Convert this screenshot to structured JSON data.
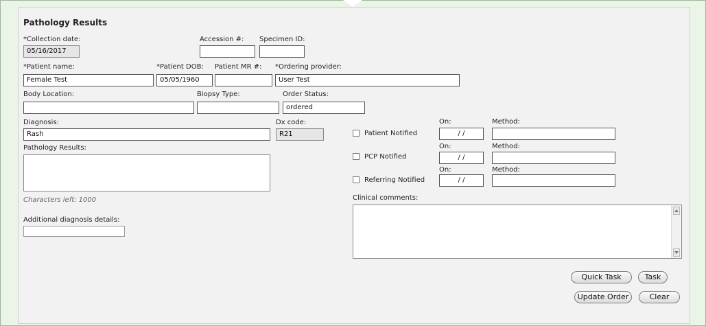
{
  "form": {
    "title": "Pathology Results",
    "collection_date": {
      "label": "*Collection date:",
      "value": "05/16/2017"
    },
    "accession": {
      "label": "Accession #:",
      "value": ""
    },
    "specimen_id": {
      "label": "Specimen ID:",
      "value": ""
    },
    "patient_name": {
      "label": "*Patient name:",
      "value": "Female Test"
    },
    "patient_dob": {
      "label": "*Patient DOB:",
      "value": "05/05/1960"
    },
    "patient_mr": {
      "label": "Patient MR #:",
      "value": ""
    },
    "ordering_provider": {
      "label": "*Ordering provider:",
      "value": "User Test"
    },
    "body_location": {
      "label": "Body Location:",
      "value": ""
    },
    "biopsy_type": {
      "label": "Biopsy Type:",
      "value": ""
    },
    "order_status": {
      "label": "Order Status:",
      "value": "ordered"
    },
    "diagnosis": {
      "label": "Diagnosis:",
      "value": "Rash"
    },
    "dx_code": {
      "label": "Dx code:",
      "value": "R21"
    },
    "pathology_results": {
      "label": "Pathology Results:",
      "value": ""
    },
    "characters_left": "Characters left: 1000",
    "additional_details": {
      "label": "Additional diagnosis details:",
      "value": ""
    },
    "clinical_comments": {
      "label": "Clinical comments:",
      "value": ""
    }
  },
  "notifications": [
    {
      "label": "Patient Notified",
      "on_label": "On:",
      "on_value": " /  /",
      "method_label": "Method:",
      "method_value": "",
      "checked": false
    },
    {
      "label": "PCP Notified",
      "on_label": "On:",
      "on_value": " /  /",
      "method_label": "Method:",
      "method_value": "",
      "checked": false
    },
    {
      "label": "Referring Notified",
      "on_label": "On:",
      "on_value": " /  /",
      "method_label": "Method:",
      "method_value": "",
      "checked": false
    }
  ],
  "buttons": {
    "quick_task": "Quick Task",
    "task": "Task",
    "update_order": "Update Order",
    "clear": "Clear"
  }
}
